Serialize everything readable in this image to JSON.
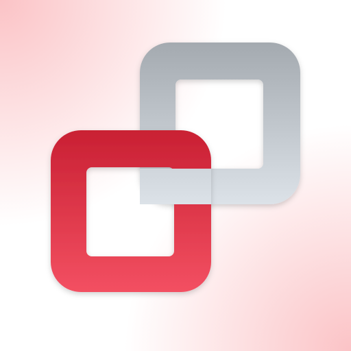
{
  "icon": {
    "name": "linked-squares-icon",
    "colors": {
      "background_tint": "#FBC3C6",
      "background_base": "#FFFFFF",
      "red_top": "#C92033",
      "red_bottom": "#F35062",
      "gray_top": "#A4AAB0",
      "gray_bottom": "#DCE2E8",
      "inner_white": "#FFFFFF"
    }
  }
}
